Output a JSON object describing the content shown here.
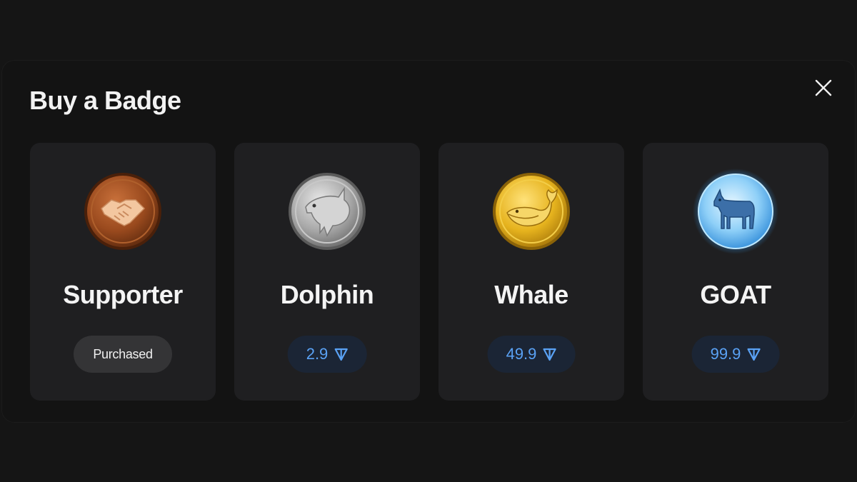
{
  "modal": {
    "title": "Buy a Badge",
    "close_icon": "close-icon"
  },
  "badges": [
    {
      "name": "Supporter",
      "icon": "handshake-badge-icon",
      "status": "Purchased"
    },
    {
      "name": "Dolphin",
      "icon": "dolphin-badge-icon",
      "price": "2.9",
      "currency_icon": "ton-icon"
    },
    {
      "name": "Whale",
      "icon": "whale-badge-icon",
      "price": "49.9",
      "currency_icon": "ton-icon"
    },
    {
      "name": "GOAT",
      "icon": "goat-badge-icon",
      "price": "99.9",
      "currency_icon": "ton-icon"
    }
  ],
  "colors": {
    "background": "#151515",
    "card": "#1f1f21",
    "price_pill": "#1b2535",
    "price_text": "#5aa2f5",
    "purchased_pill": "#343436"
  }
}
